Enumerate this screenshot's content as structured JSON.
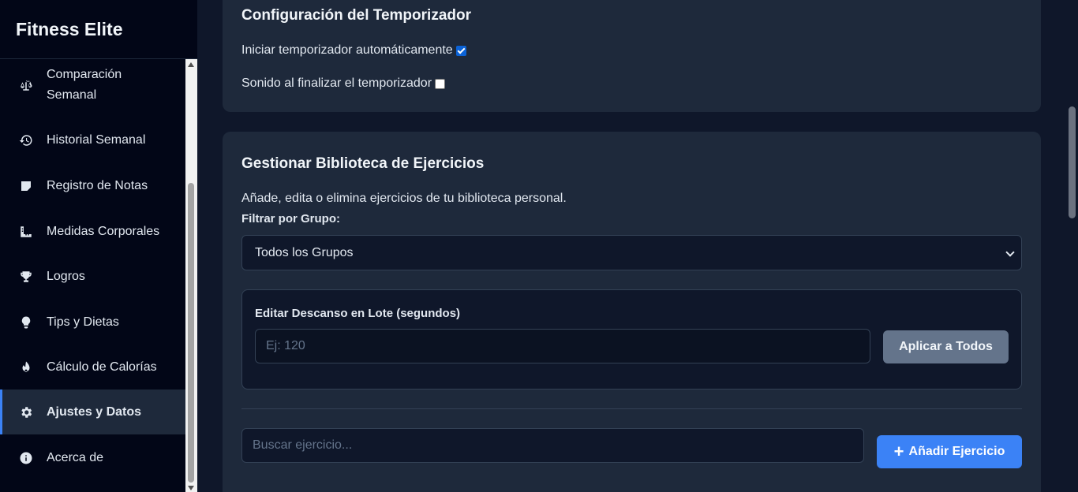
{
  "app": {
    "title": "Fitness Elite"
  },
  "sidebar": {
    "items": [
      {
        "label": "Comparación Semanal",
        "icon": "scale-balance-icon"
      },
      {
        "label": "Historial Semanal",
        "icon": "history-icon"
      },
      {
        "label": "Registro de Notas",
        "icon": "sticky-note-icon"
      },
      {
        "label": "Medidas Corporales",
        "icon": "ruler-icon"
      },
      {
        "label": "Logros",
        "icon": "trophy-icon"
      },
      {
        "label": "Tips y Dietas",
        "icon": "lightbulb-icon"
      },
      {
        "label": "Cálculo de Calorías",
        "icon": "fire-icon"
      },
      {
        "label": "Ajustes y Datos",
        "icon": "gear-icon",
        "active": true
      },
      {
        "label": "Acerca de",
        "icon": "info-icon"
      }
    ]
  },
  "timer": {
    "title": "Configuración del Temporizador",
    "auto_start_label": "Iniciar temporizador automáticamente",
    "auto_start_checked": true,
    "sound_label": "Sonido al finalizar el temporizador",
    "sound_checked": false
  },
  "library": {
    "title": "Gestionar Biblioteca de Ejercicios",
    "description": "Añade, edita o elimina ejercicios de tu biblioteca personal.",
    "filter_label": "Filtrar por Grupo:",
    "filter_value": "Todos los Grupos",
    "batch_label": "Editar Descanso en Lote (segundos)",
    "batch_placeholder": "Ej: 120",
    "apply_button": "Aplicar a Todos",
    "search_placeholder": "Buscar ejercicio...",
    "add_button": "Añadir Ejercicio"
  },
  "colors": {
    "accent": "#3b82f6",
    "sidebar_bg": "#020617",
    "card_bg": "#1e293b",
    "page_bg": "#0f172a"
  }
}
